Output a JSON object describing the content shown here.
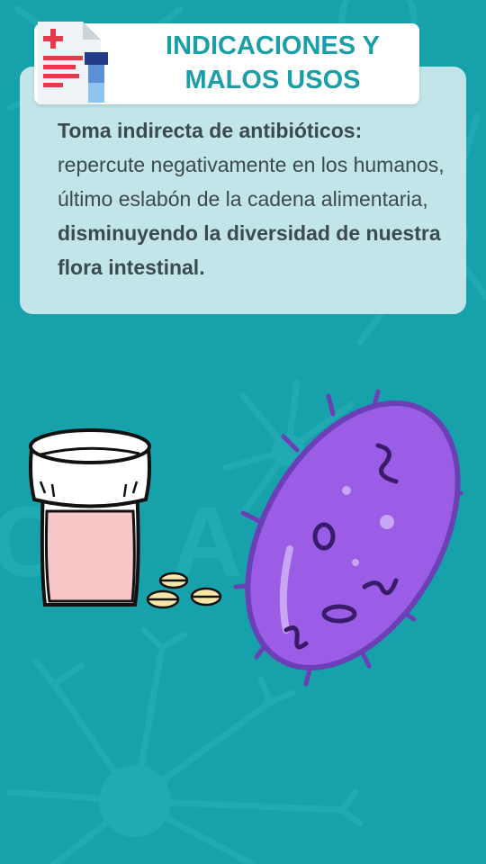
{
  "title": {
    "line1": "INDICACIONES Y",
    "line2": "MALOS USOS"
  },
  "paragraph": {
    "bold_lead": "Toma indirecta de antibióticos:",
    "text1": " repercute negativamente en los humanos, último eslabón de la cadena alimentaria, ",
    "bold_tail": "disminuyendo la diversidad de nuestra flora intestinal."
  },
  "icons": {
    "document": "medical-document-icon",
    "pill_bottle": "pill-bottle-icon",
    "pills": "pills-icon",
    "bacterium": "bacterium-icon"
  },
  "colors": {
    "background": "#17a2ab",
    "title": "#1a9ea7",
    "text": "#3b4a4f",
    "bacterium": "#9b5de5",
    "pill_liquid": "#f7c6c7",
    "pills": "#f6e7a9"
  }
}
